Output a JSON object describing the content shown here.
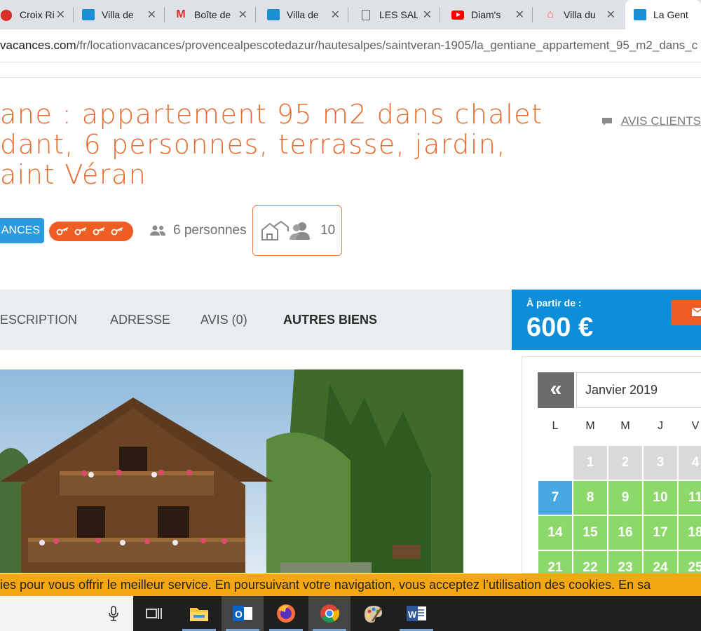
{
  "browser": {
    "tabs": [
      {
        "label": "Croix Ri",
        "icon": "maps-icon",
        "active": false
      },
      {
        "label": "Villa de",
        "icon": "opod-icon",
        "active": false
      },
      {
        "label": "Boîte de",
        "icon": "gmail-icon",
        "active": false
      },
      {
        "label": "Villa de",
        "icon": "opod-icon",
        "active": false
      },
      {
        "label": "LES SAL",
        "icon": "document-icon",
        "active": false
      },
      {
        "label": "Diam's",
        "icon": "youtube-icon",
        "active": false
      },
      {
        "label": "Villa du",
        "icon": "airbnb-icon",
        "active": false
      },
      {
        "label": "La Gent",
        "icon": "opod-icon",
        "active": true
      }
    ],
    "url_host": "vacances.com",
    "url_path": "/fr/locationvacances/provencealpescotedazur/hautesalpes/saintveran-1905/la_gentiane_appartement_95_m2_dans_c"
  },
  "listing": {
    "title_lines": [
      "ane : appartement 95 m2 dans chalet",
      "dant, 6 personnes, terrasse, jardin,",
      "aint Véran"
    ],
    "reviews_link": "AVIS CLIENTS (",
    "badge_label": "ANCES",
    "keys": "⚷⚷⚷⚷",
    "key_count": 4,
    "capacity_label": "6 personnes",
    "group_capacity": "10"
  },
  "tabs": {
    "description": "ESCRIPTION",
    "address": "ADRESSE",
    "reviews": "AVIS (0)",
    "other": "AUTRES BIENS"
  },
  "price": {
    "from_label": "À partir de :",
    "amount": "600 €"
  },
  "calendar": {
    "month": "Janvier 2019",
    "prev_label": "«",
    "weekdays": [
      "L",
      "M",
      "M",
      "J",
      "V"
    ],
    "rows": [
      [
        {
          "d": "",
          "s": ""
        },
        {
          "d": "1",
          "s": "past"
        },
        {
          "d": "2",
          "s": "past"
        },
        {
          "d": "3",
          "s": "past"
        },
        {
          "d": "4",
          "s": "past"
        }
      ],
      [
        {
          "d": "7",
          "s": "today"
        },
        {
          "d": "8",
          "s": "avail"
        },
        {
          "d": "9",
          "s": "avail"
        },
        {
          "d": "10",
          "s": "avail"
        },
        {
          "d": "11",
          "s": "avail"
        }
      ],
      [
        {
          "d": "14",
          "s": "avail"
        },
        {
          "d": "15",
          "s": "avail"
        },
        {
          "d": "16",
          "s": "avail"
        },
        {
          "d": "17",
          "s": "avail"
        },
        {
          "d": "18",
          "s": "avail"
        }
      ],
      [
        {
          "d": "21",
          "s": "avail"
        },
        {
          "d": "22",
          "s": "avail"
        },
        {
          "d": "23",
          "s": "avail"
        },
        {
          "d": "24",
          "s": "avail"
        },
        {
          "d": "25",
          "s": "avail"
        }
      ]
    ]
  },
  "cookie_text": "ies pour vous offrir le meilleur service. En poursuivant votre navigation, vous acceptez l’utilisation des cookies.    En sa",
  "taskbar": {
    "apps": [
      "task-view-icon",
      "file-explorer-icon",
      "outlook-icon",
      "firefox-icon",
      "chrome-icon",
      "paint-icon",
      "word-icon"
    ]
  },
  "colors": {
    "accent_orange": "#ef5d24",
    "title_orange": "#e9692c",
    "price_blue": "#0c8fd8",
    "available_green": "#8cd96a",
    "past_grey": "#d9d9d9",
    "today_blue": "#47a7e0",
    "cookie_yellow": "#f5a711"
  }
}
